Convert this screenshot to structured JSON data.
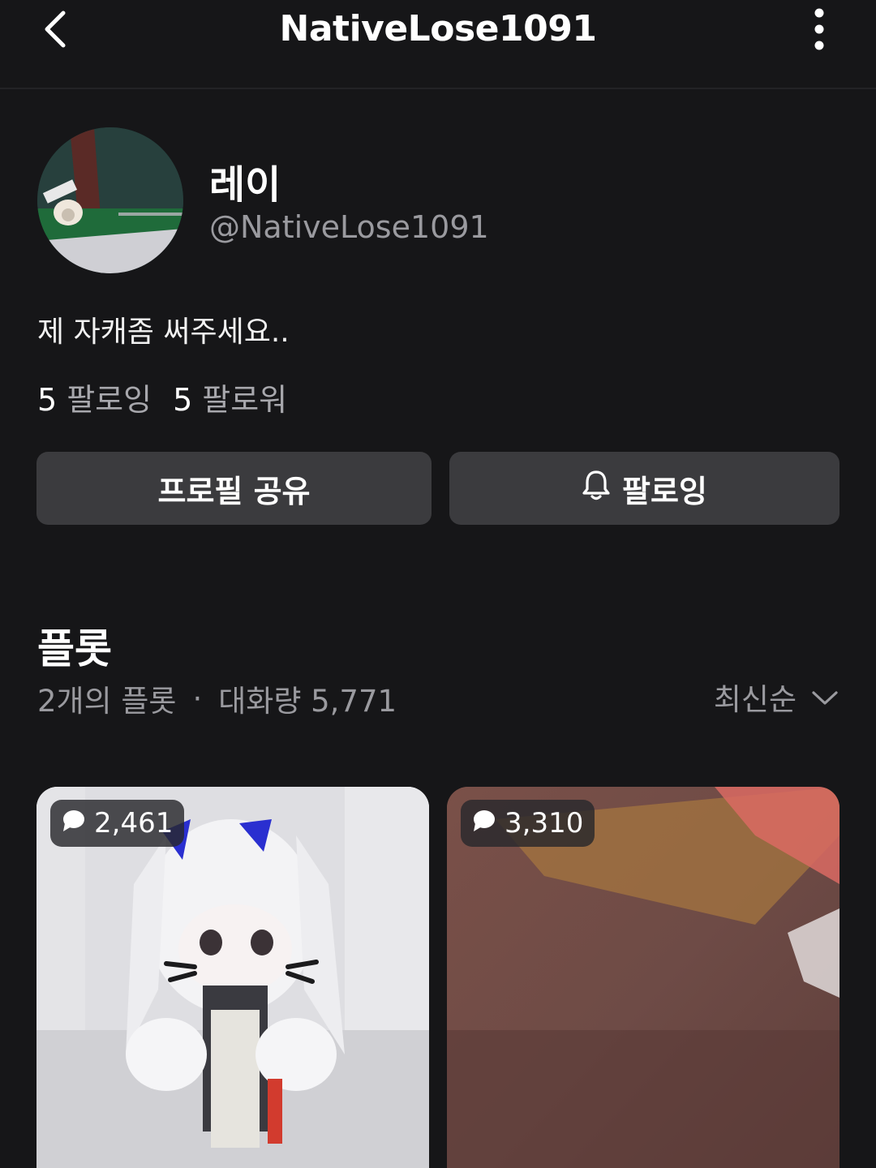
{
  "header": {
    "title": "NativeLose1091",
    "back_icon": "chevron-left-icon",
    "more_icon": "more-vertical-icon"
  },
  "profile": {
    "display_name": "레이",
    "handle": "@NativeLose1091",
    "bio": "제 자캐좀 써주세요..",
    "following_count": "5",
    "following_label": "팔로잉",
    "followers_count": "5",
    "followers_label": "팔로워"
  },
  "actions": {
    "share_label": "프로필 공유",
    "follow_label": "팔로잉",
    "follow_icon": "bell-icon"
  },
  "plots": {
    "title": "플롯",
    "count_text": "2개의 플롯",
    "separator": "·",
    "conversation_text": "대화량 5,771",
    "sort_label": "최신순",
    "cards": [
      {
        "chat_count": "2,461"
      },
      {
        "chat_count": "3,310"
      }
    ]
  },
  "colors": {
    "background": "#161618",
    "button_bg": "#3b3b3e",
    "secondary_text": "#9a9a9f"
  }
}
